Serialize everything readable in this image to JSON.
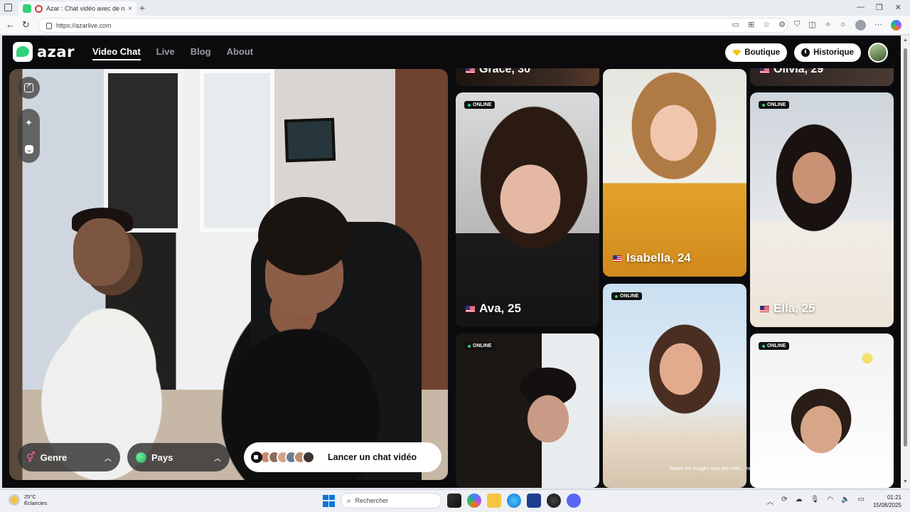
{
  "browser": {
    "tab_title": "Azar : Chat vidéo avec de no",
    "url": "https://azarlive.com",
    "new_tab": "+",
    "tab_close": "×"
  },
  "nav": {
    "logo_text": "azar",
    "links": [
      "Video Chat",
      "Live",
      "Blog",
      "About"
    ],
    "boutique": "Boutique",
    "historique": "Historique"
  },
  "controls": {
    "genre": "Genre",
    "pays": "Pays",
    "launch": "Lancer un chat vidéo"
  },
  "profiles": [
    {
      "name": "Grace, 30",
      "online": ""
    },
    {
      "name": "Olivia, 29",
      "online": ""
    },
    {
      "name": "Ava, 25",
      "online": "ONLINE"
    },
    {
      "name": "Isabella, 24",
      "online": ""
    },
    {
      "name": "Ella, 25",
      "online": "ONLINE"
    },
    {
      "name": "",
      "online": "ONLINE"
    },
    {
      "name": "",
      "online": "ONLINE"
    },
    {
      "name": "",
      "online": "ONLINE"
    }
  ],
  "disclaimer": "Toutes les images sont des mod... ées à des fins d'illustration uniquement.",
  "taskbar": {
    "temp": "25°C",
    "condition": "Éclaircies",
    "search": "Rechercher",
    "time": "01:21",
    "date": "15/08/2025"
  },
  "colors": {
    "accent": "#2fd27a",
    "page_bg": "#0b0b0d"
  }
}
